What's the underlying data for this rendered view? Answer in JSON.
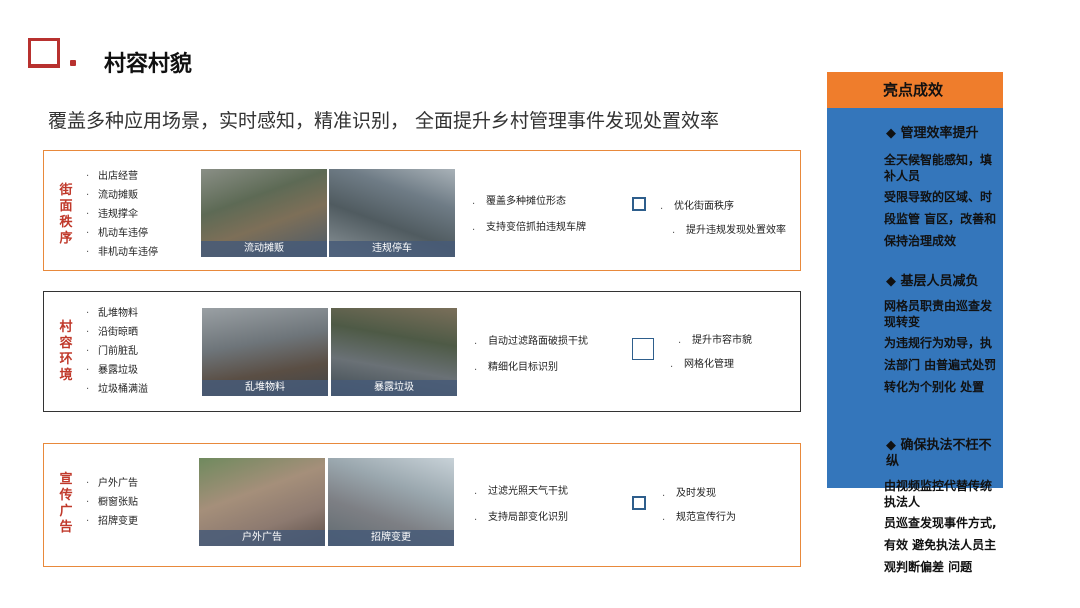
{
  "header": {
    "title": "村容村貌"
  },
  "subtitle": "覆盖多种应用场景，实时感知，精准识别，   全面提升乡村管理事件发现处置效率",
  "rows": [
    {
      "category": "街面秩序",
      "items": [
        "出店经营",
        "流动摊贩",
        "违规撑伞",
        "机动车违停",
        "非机动车违停"
      ],
      "captions": [
        "流动摊贩",
        "违规停车"
      ],
      "features": [
        "覆盖多种摊位形态",
        "支持变倍抓拍违规车牌"
      ],
      "results": [
        "优化街面秩序",
        "提升违规发现处置效率"
      ]
    },
    {
      "category": "村容环境",
      "items": [
        "乱堆物料",
        "沿街晾晒",
        "门前脏乱",
        "暴露垃圾",
        "垃圾桶满溢"
      ],
      "captions": [
        "乱堆物料",
        "暴露垃圾"
      ],
      "features": [
        "自动过滤路面破损干扰",
        "精细化目标识别"
      ],
      "results": [
        "提升市容市貌",
        "网格化管理"
      ]
    },
    {
      "category": "宣传广告",
      "items": [
        "户外广告",
        "橱窗张贴",
        "招牌变更"
      ],
      "captions": [
        "户外广告",
        "招牌变更"
      ],
      "features": [
        "过滤光照天气干扰",
        "支持局部变化识别"
      ],
      "results": [
        "及时发现",
        "规范宣传行为"
      ]
    }
  ],
  "panel": {
    "title": "亮点成效",
    "sections": [
      {
        "heading": "◆  管理效率提升",
        "lines": [
          "全天候智能感知，填补人员",
          "受限导致的区域、时段监管   盲区，改善和保持治理成效"
        ]
      },
      {
        "heading": "◆  基层人员减负",
        "lines": [
          "网格员职责由巡查发现转变",
          "为违规行为劝导，执法部门   由普遍式处罚转化为个别化   处置"
        ]
      },
      {
        "heading": "◆  确保执法不枉不纵",
        "lines": [
          "由视频监控代替传统执法人",
          "员巡查发现事件方式,有效   避免执法人员主观判断偏差   问题"
        ]
      }
    ]
  },
  "colors": {
    "accent_red": "#b8312f",
    "panel_blue": "#3476bb",
    "panel_orange": "#ef7d2c",
    "row_border_orange": "#e8893b"
  }
}
